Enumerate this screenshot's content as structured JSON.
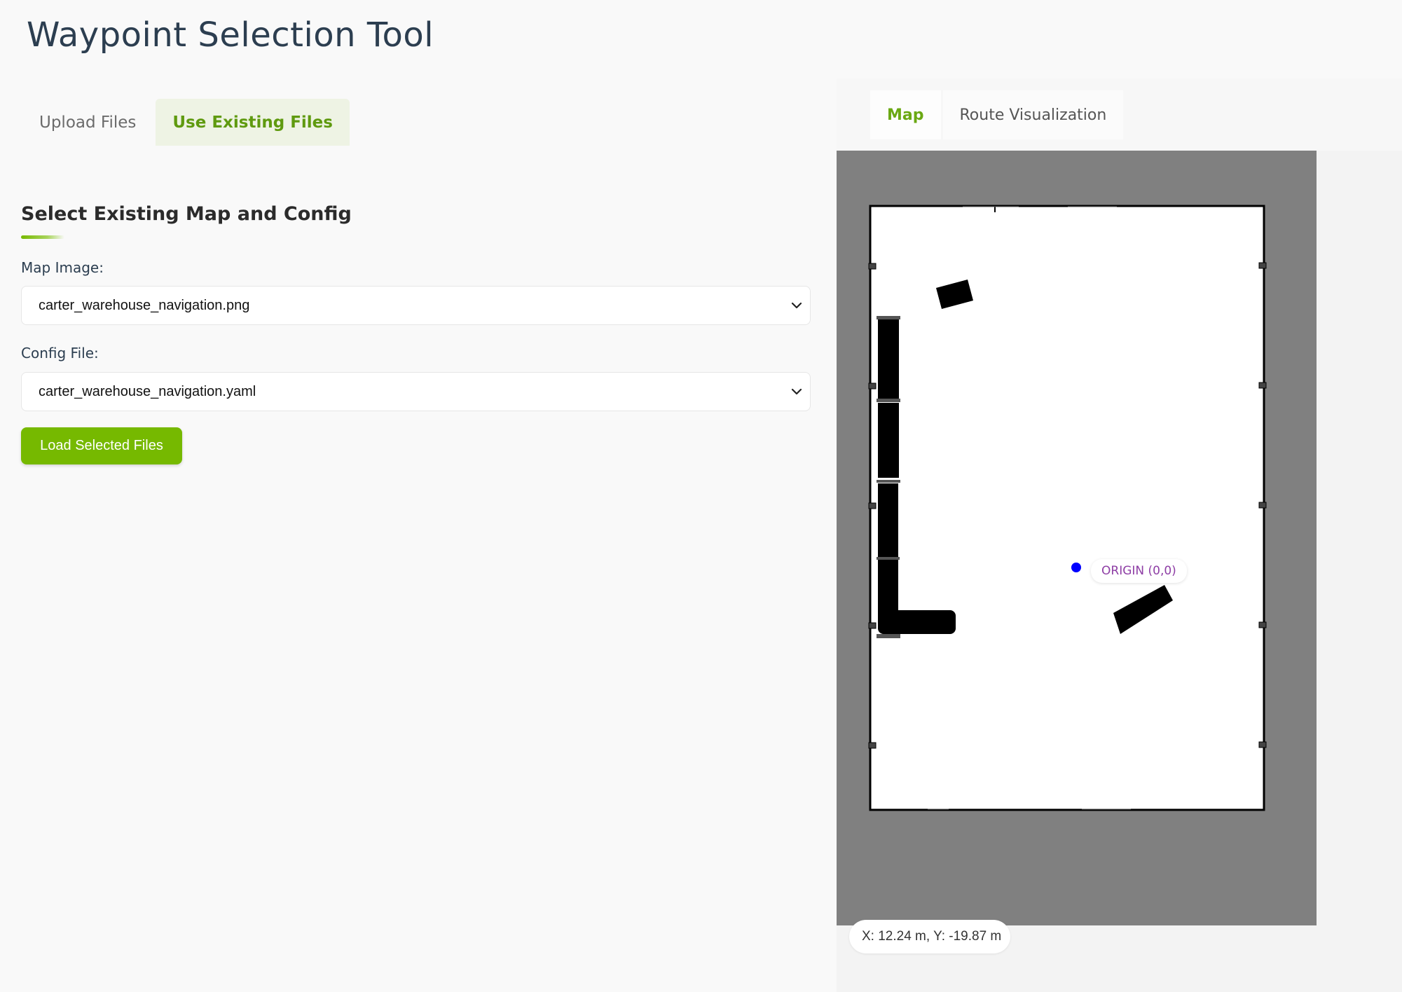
{
  "page": {
    "title": "Waypoint Selection Tool"
  },
  "left_tabs": [
    {
      "label": "Upload Files",
      "active": false
    },
    {
      "label": "Use Existing Files",
      "active": true
    }
  ],
  "section": {
    "heading": "Select Existing Map and Config",
    "map_image": {
      "label": "Map Image:",
      "selected": "carter_warehouse_navigation.png"
    },
    "config_file": {
      "label": "Config File:",
      "selected": "carter_warehouse_navigation.yaml"
    },
    "load_button": "Load Selected Files"
  },
  "right_tabs": [
    {
      "label": "Map",
      "active": true
    },
    {
      "label": "Route Visualization",
      "active": false
    }
  ],
  "map": {
    "origin_label": "ORIGIN (0,0)",
    "coordinate_readout": "X: 12.24 m, Y: -19.87 m",
    "colors": {
      "accent": "#76b900",
      "origin_marker": "#0000ff",
      "origin_label": "#8e3ea5",
      "unknown_area": "#808080",
      "free_space": "#ffffff",
      "obstacle": "#000000"
    }
  },
  "icons": {
    "select_chevron": "chevron-down-icon"
  }
}
